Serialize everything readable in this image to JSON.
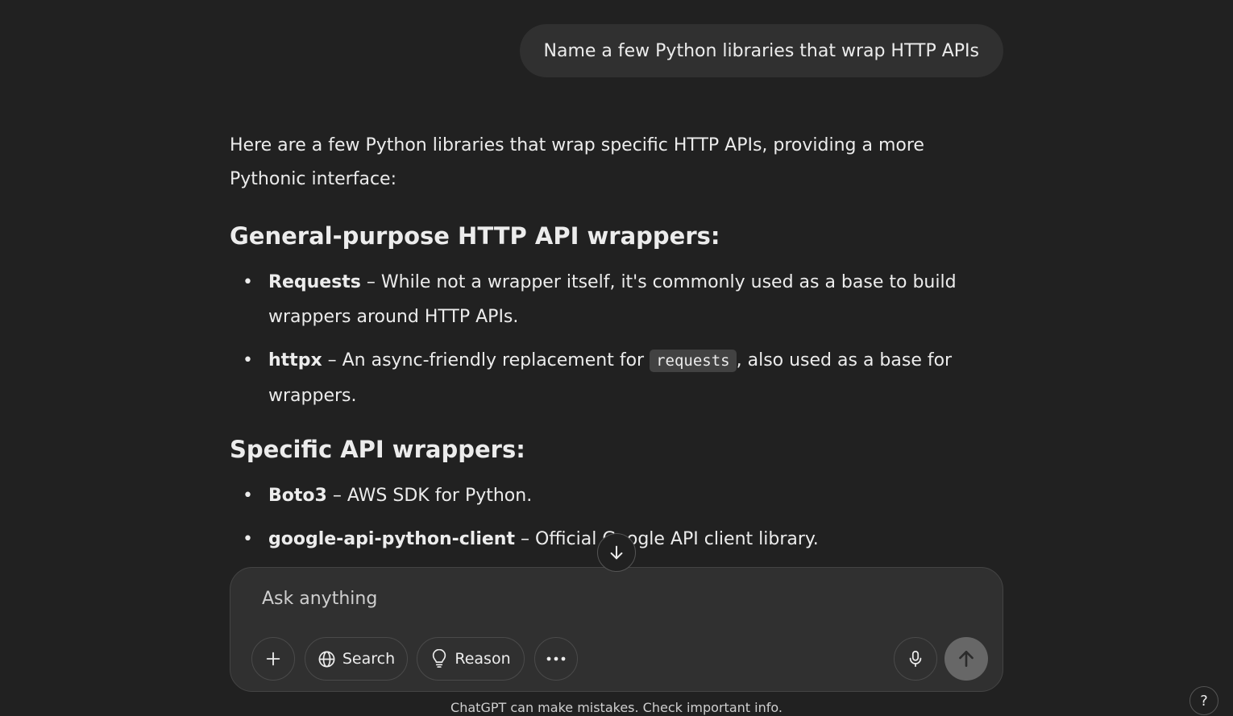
{
  "conversation": {
    "user_message": "Name a few Python libraries that wrap HTTP APIs",
    "intro": "Here are a few Python libraries that wrap specific HTTP APIs, providing a more Pythonic interface:",
    "section1": {
      "heading": "General-purpose HTTP API wrappers:",
      "items": [
        {
          "name": "Requests",
          "text": " – While not a wrapper itself, it's commonly used as a base to build wrappers around HTTP APIs."
        },
        {
          "name": "httpx",
          "text_before": " – An async-friendly replacement for ",
          "code": "requests",
          "text_after": ", also used as a base for wrappers."
        }
      ]
    },
    "section2": {
      "heading": "Specific API wrappers:",
      "items": [
        {
          "name": "Boto3",
          "text": " – AWS SDK for Python."
        },
        {
          "name": "google-api-python-client",
          "text": " – Official Google API client library."
        }
      ]
    }
  },
  "composer": {
    "placeholder": "Ask anything",
    "search_label": "Search",
    "reason_label": "Reason",
    "icons": [
      "plus-icon",
      "globe-icon",
      "lightbulb-icon",
      "more-icon",
      "microphone-icon",
      "arrow-up-icon"
    ]
  },
  "footer": {
    "note": "ChatGPT can make mistakes. Check important info.",
    "help_label": "?"
  },
  "colors": {
    "background": "#212121",
    "bubble": "#303030",
    "text": "#ececec",
    "send_button": "#676767"
  }
}
